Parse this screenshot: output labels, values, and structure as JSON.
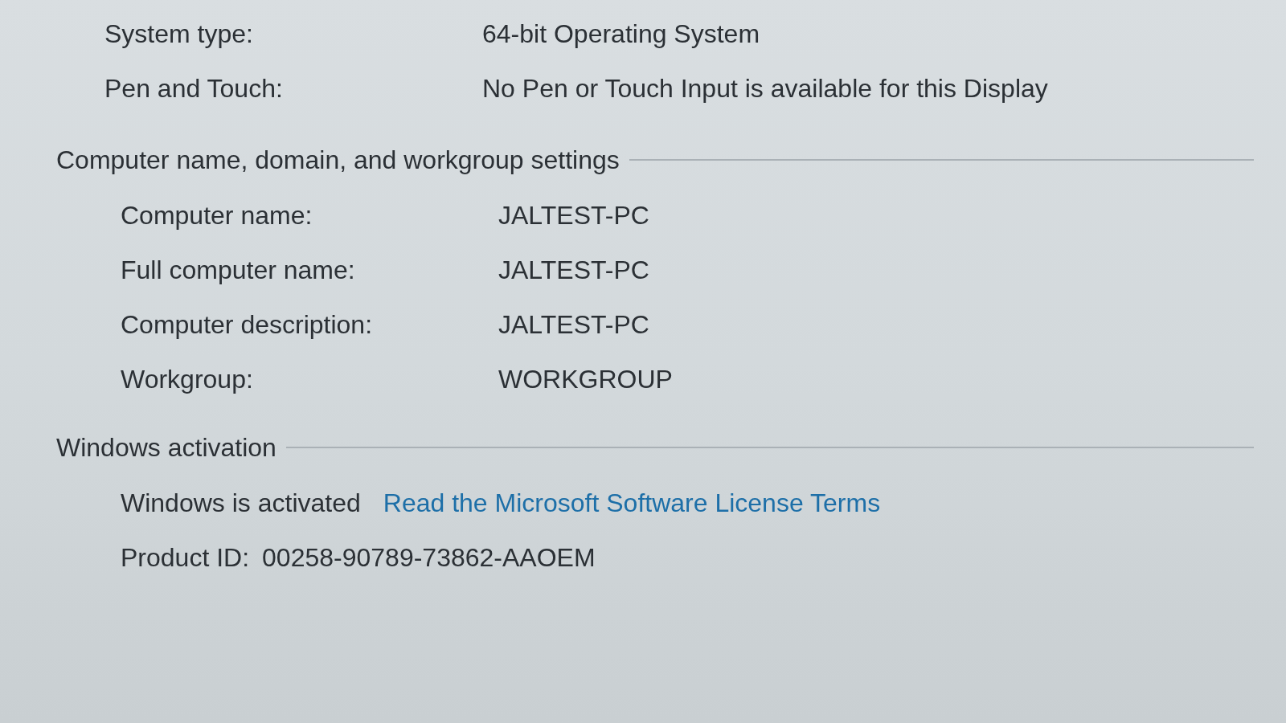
{
  "system_rows": [
    {
      "label": "System type:",
      "value": "64-bit Operating System"
    },
    {
      "label": "Pen and Touch:",
      "value": "No Pen or Touch Input is available for this Display"
    }
  ],
  "computer_section": {
    "heading": "Computer name, domain, and workgroup settings",
    "rows": [
      {
        "label": "Computer name:",
        "value": "JALTEST-PC"
      },
      {
        "label": "Full computer name:",
        "value": "JALTEST-PC"
      },
      {
        "label": "Computer description:",
        "value": "JALTEST-PC"
      },
      {
        "label": "Workgroup:",
        "value": "WORKGROUP"
      }
    ]
  },
  "activation_section": {
    "heading": "Windows activation",
    "status": "Windows is activated",
    "license_link": "Read the Microsoft Software License Terms",
    "product_id_label": "Product ID:",
    "product_id": "00258-90789-73862-AAOEM"
  }
}
